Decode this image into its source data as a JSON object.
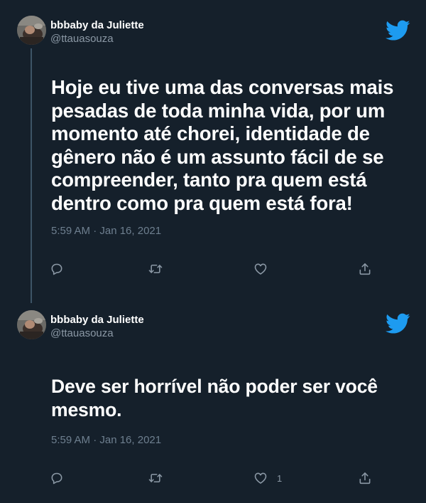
{
  "theme": {
    "background": "#15202b",
    "text_primary": "#ffffff",
    "text_secondary": "#8b98a5",
    "brand_blue": "#1d9bf0"
  },
  "tweets": [
    {
      "author": {
        "display_name": "bbbaby da Juliette",
        "handle": "@ttauasouza"
      },
      "text": "Hoje eu tive uma das conversas mais pesadas de toda minha vida, por um momento até chorei, identidade de gênero não é um assunto fácil de se compreender, tanto pra quem está dentro como pra quem está fora!",
      "timestamp": "5:59 AM · Jan 16, 2021",
      "icons": {
        "brand": "twitter-bird-icon",
        "reply": "reply-icon",
        "retweet": "retweet-icon",
        "like": "heart-icon",
        "share": "share-icon"
      },
      "like_count": ""
    },
    {
      "author": {
        "display_name": "bbbaby da Juliette",
        "handle": "@ttauasouza"
      },
      "text": "Deve ser horrível não poder ser você mesmo.",
      "timestamp": "5:59 AM · Jan 16, 2021",
      "icons": {
        "brand": "twitter-bird-icon",
        "reply": "reply-icon",
        "retweet": "retweet-icon",
        "like": "heart-icon",
        "share": "share-icon"
      },
      "like_count": "1"
    }
  ]
}
